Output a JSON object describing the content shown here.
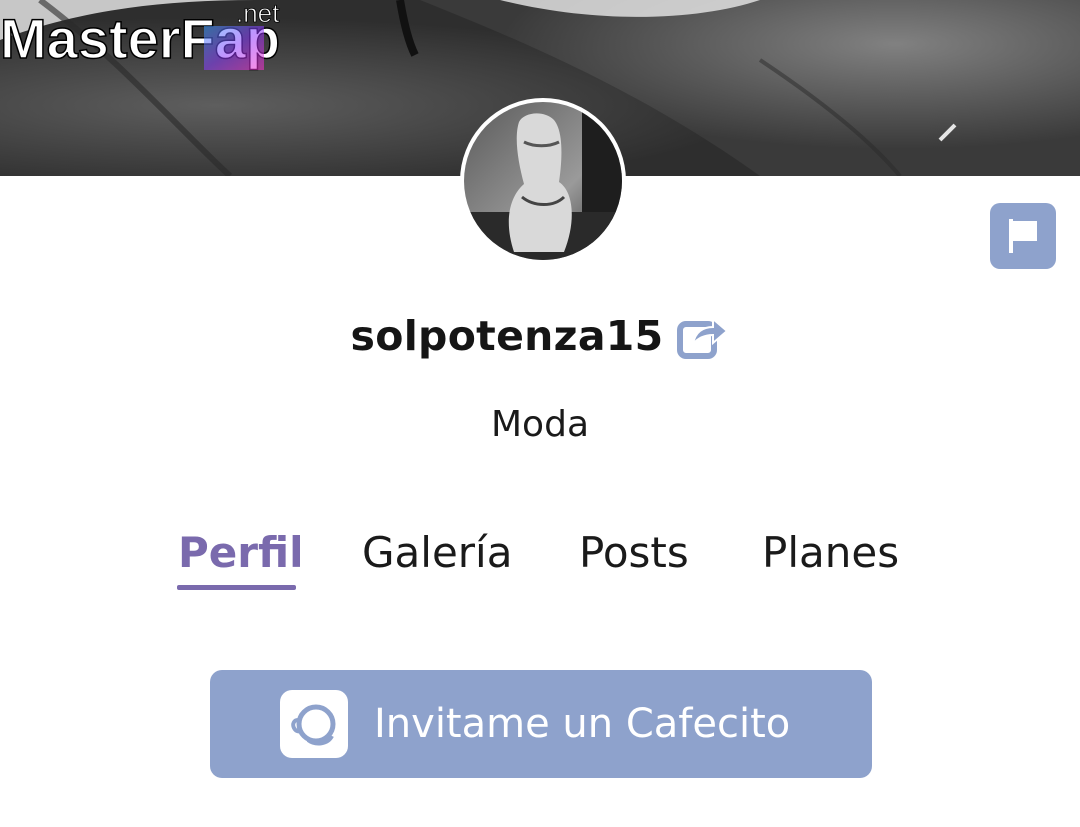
{
  "cover": {
    "watermark_main": "MasterFap",
    "watermark_tld": ".net"
  },
  "profile": {
    "username": "solpotenza15",
    "category": "Moda"
  },
  "tabs": [
    {
      "label": "Perfil",
      "active": true
    },
    {
      "label": "Galería",
      "active": false
    },
    {
      "label": "Posts",
      "active": false
    },
    {
      "label": "Planes",
      "active": false
    }
  ],
  "cta": {
    "label": "Invitame un Cafecito"
  },
  "icons": {
    "share": "share-icon",
    "report": "flag-icon",
    "cafecito": "cafecito-logo-icon"
  },
  "colors": {
    "accent": "#7a6aad",
    "button": "#8ea2cc",
    "text": "#1a1a1a",
    "watermark_gradient": [
      "#3aa0ff",
      "#8a3cff",
      "#ff2fd0"
    ]
  }
}
